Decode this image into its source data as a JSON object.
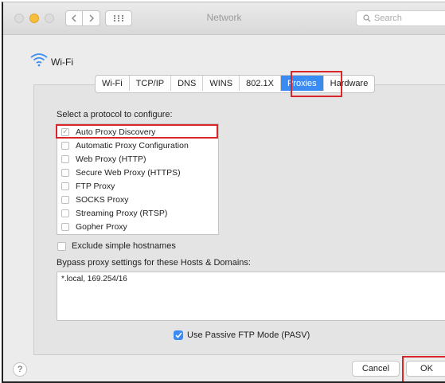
{
  "window": {
    "title": "Network",
    "search_placeholder": "Search"
  },
  "header": {
    "service_name": "Wi-Fi"
  },
  "tabs": [
    {
      "label": "Wi-Fi"
    },
    {
      "label": "TCP/IP"
    },
    {
      "label": "DNS"
    },
    {
      "label": "WINS"
    },
    {
      "label": "802.1X"
    },
    {
      "label": "Proxies",
      "active": true
    },
    {
      "label": "Hardware"
    }
  ],
  "proxies": {
    "protocol_prompt": "Select a protocol to configure:",
    "protocols": [
      {
        "label": "Auto Proxy Discovery",
        "checked": true
      },
      {
        "label": "Automatic Proxy Configuration",
        "checked": false
      },
      {
        "label": "Web Proxy (HTTP)",
        "checked": false
      },
      {
        "label": "Secure Web Proxy (HTTPS)",
        "checked": false
      },
      {
        "label": "FTP Proxy",
        "checked": false
      },
      {
        "label": "SOCKS Proxy",
        "checked": false
      },
      {
        "label": "Streaming Proxy (RTSP)",
        "checked": false
      },
      {
        "label": "Gopher Proxy",
        "checked": false
      }
    ],
    "exclude_simple_hostnames": "Exclude simple hostnames",
    "bypass_label": "Bypass proxy settings for these Hosts & Domains:",
    "bypass_value": "*.local, 169.254/16",
    "passive_ftp_label": "Use Passive FTP Mode (PASV)"
  },
  "footer": {
    "help": "?",
    "cancel": "Cancel",
    "ok": "OK"
  },
  "colors": {
    "accent": "#3a8cf2",
    "highlight": "#d8262b"
  }
}
